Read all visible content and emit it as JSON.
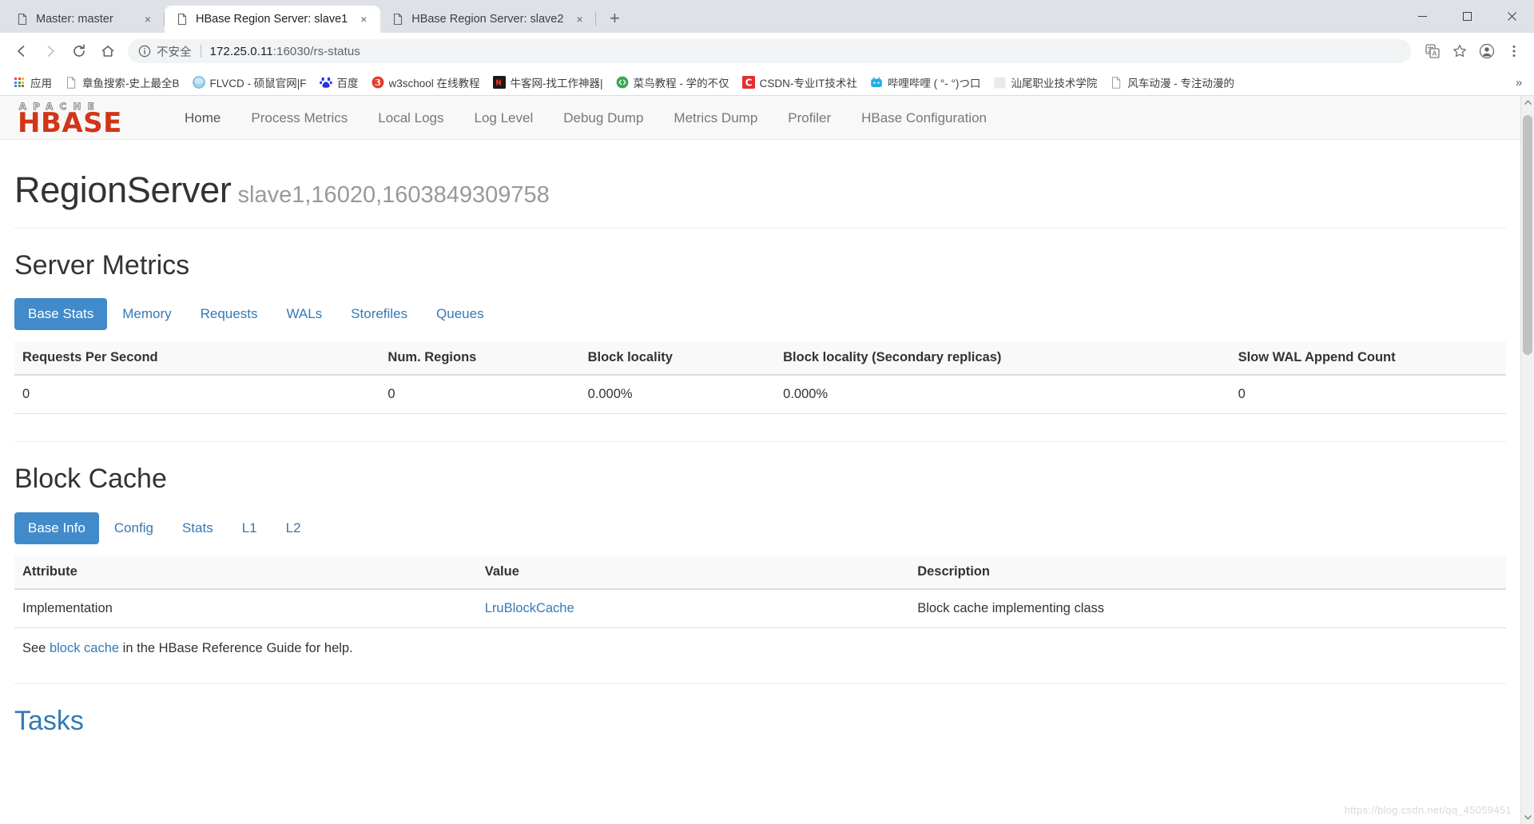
{
  "browser": {
    "tabs": [
      {
        "title": "Master: master",
        "active": false,
        "icon": "page-icon"
      },
      {
        "title": "HBase Region Server: slave1",
        "active": true,
        "icon": "page-icon"
      },
      {
        "title": "HBase Region Server: slave2",
        "active": false,
        "icon": "page-icon"
      }
    ],
    "new_tab_label": "+",
    "close_label": "×",
    "window_controls": {
      "minimize": "—",
      "maximize": "☐",
      "close": "✕"
    },
    "nav": {
      "back": "←",
      "forward": "→",
      "reload": "↻",
      "home": "⌂"
    },
    "omnibox": {
      "security_label": "不安全",
      "info_icon": "info-circle-icon",
      "url_host": "172.25.0.11",
      "url_rest": ":16030/rs-status",
      "full_url": "172.25.0.11:16030/rs-status"
    },
    "toolbar_icons": [
      {
        "name": "translate-icon",
        "glyph": "文"
      },
      {
        "name": "bookmark-star-icon",
        "glyph": "☆"
      },
      {
        "name": "profile-avatar-icon",
        "glyph": "●"
      },
      {
        "name": "chrome-menu-icon",
        "glyph": "⋮"
      }
    ],
    "bookmarks": [
      {
        "label": "应用",
        "icon": "apps-grid-icon"
      },
      {
        "label": "章鱼搜索-史上最全B",
        "icon": "page-icon"
      },
      {
        "label": "FLVCD - 硕鼠官网|F",
        "icon": "flvcd-icon"
      },
      {
        "label": "百度",
        "icon": "baidu-icon"
      },
      {
        "label": "w3school 在线教程",
        "icon": "w3school-icon"
      },
      {
        "label": "牛客网-找工作神器|",
        "icon": "nowcoder-icon"
      },
      {
        "label": "菜鸟教程 - 学的不仅",
        "icon": "runoob-icon"
      },
      {
        "label": "CSDN-专业IT技术社",
        "icon": "csdn-icon"
      },
      {
        "label": "哔哩哔哩 ( °- °)つ口",
        "icon": "bilibili-icon"
      },
      {
        "label": "汕尾职业技术学院",
        "icon": "blank-icon"
      },
      {
        "label": "风车动漫 - 专注动漫的",
        "icon": "page-icon"
      }
    ],
    "bookmark_overflow": "»"
  },
  "site": {
    "brand": {
      "top": "A P A C H E",
      "main": "HBASE"
    },
    "navlinks": [
      {
        "label": "Home",
        "active": true
      },
      {
        "label": "Process Metrics",
        "active": false
      },
      {
        "label": "Local Logs",
        "active": false
      },
      {
        "label": "Log Level",
        "active": false
      },
      {
        "label": "Debug Dump",
        "active": false
      },
      {
        "label": "Metrics Dump",
        "active": false
      },
      {
        "label": "Profiler",
        "active": false
      },
      {
        "label": "HBase Configuration",
        "active": false
      }
    ]
  },
  "page": {
    "title": "RegionServer",
    "subtitle": "slave1,16020,1603849309758",
    "server_metrics": {
      "heading": "Server Metrics",
      "tabs": [
        {
          "label": "Base Stats",
          "selected": true
        },
        {
          "label": "Memory",
          "selected": false
        },
        {
          "label": "Requests",
          "selected": false
        },
        {
          "label": "WALs",
          "selected": false
        },
        {
          "label": "Storefiles",
          "selected": false
        },
        {
          "label": "Queues",
          "selected": false
        }
      ],
      "columns": [
        "Requests Per Second",
        "Num. Regions",
        "Block locality",
        "Block locality (Secondary replicas)",
        "Slow WAL Append Count"
      ],
      "rows": [
        [
          "0",
          "0",
          "0.000%",
          "0.000%",
          "0"
        ]
      ]
    },
    "block_cache": {
      "heading": "Block Cache",
      "tabs": [
        {
          "label": "Base Info",
          "selected": true
        },
        {
          "label": "Config",
          "selected": false
        },
        {
          "label": "Stats",
          "selected": false
        },
        {
          "label": "L1",
          "selected": false
        },
        {
          "label": "L2",
          "selected": false
        }
      ],
      "columns": [
        "Attribute",
        "Value",
        "Description"
      ],
      "rows": [
        {
          "attribute": "Implementation",
          "value": "LruBlockCache",
          "value_is_link": true,
          "description": "Block cache implementing class"
        }
      ],
      "note_prefix": "See ",
      "note_link": "block cache",
      "note_suffix": " in the HBase Reference Guide for help."
    },
    "tasks": {
      "heading": "Tasks"
    }
  },
  "watermark": "https://blog.csdn.net/qq_45059451",
  "colors": {
    "accent_blue": "#428bca",
    "link_blue": "#337ab7",
    "hbase_red": "#d13518",
    "navbar_bg": "#f8f8f8",
    "tabstrip_bg": "#dee1e6"
  }
}
